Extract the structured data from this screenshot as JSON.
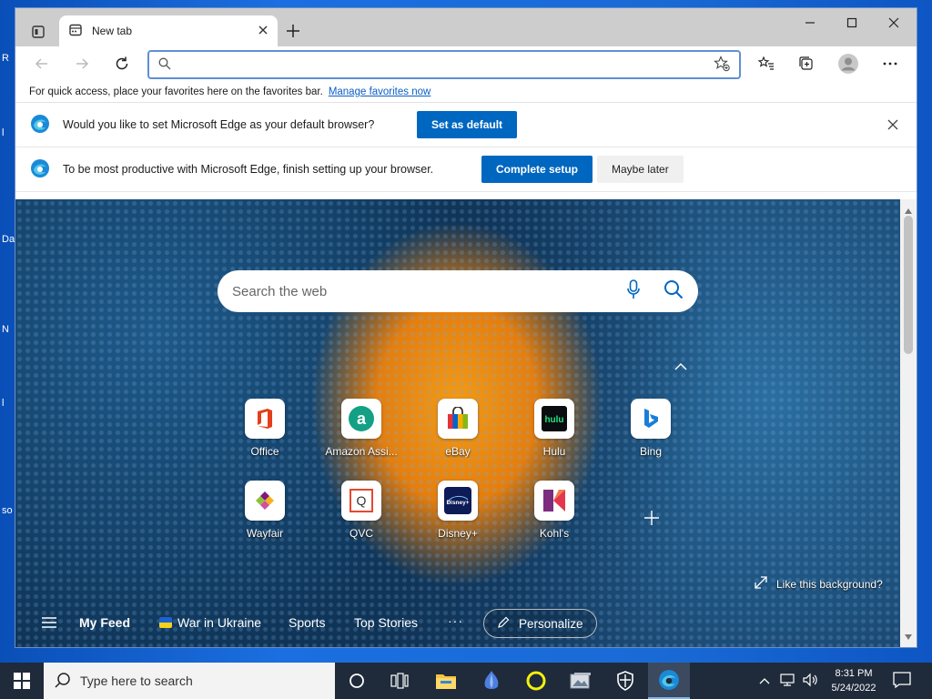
{
  "desktop": {
    "edge_letters": [
      "R",
      "l",
      "Da",
      "N",
      "l",
      "so"
    ]
  },
  "browser": {
    "tab": {
      "title": "New tab"
    },
    "address": {
      "value": "",
      "placeholder": ""
    },
    "favorites_bar": {
      "message": "For quick access, place your favorites here on the favorites bar.",
      "link": "Manage favorites now"
    },
    "infobars": [
      {
        "message": "Would you like to set Microsoft Edge as your default browser?",
        "button": "Set as default"
      },
      {
        "message": "To be most productive with Microsoft Edge, finish setting up your browser.",
        "primary": "Complete setup",
        "secondary": "Maybe later"
      }
    ]
  },
  "ntp": {
    "search_placeholder": "Search the web",
    "tiles": [
      {
        "label": "Office",
        "icon": "office-icon"
      },
      {
        "label": "Amazon Assi...",
        "icon": "amazon-icon"
      },
      {
        "label": "eBay",
        "icon": "ebay-icon"
      },
      {
        "label": "Hulu",
        "icon": "hulu-icon"
      },
      {
        "label": "Bing",
        "icon": "bing-icon"
      },
      {
        "label": "Wayfair",
        "icon": "wayfair-icon"
      },
      {
        "label": "QVC",
        "icon": "qvc-icon"
      },
      {
        "label": "Disney+",
        "icon": "disney-icon"
      },
      {
        "label": "Kohl's",
        "icon": "kohls-icon"
      }
    ],
    "like_background": "Like this background?",
    "feed": {
      "my_feed": "My Feed",
      "tabs": [
        "War in Ukraine",
        "Sports",
        "Top Stories"
      ],
      "more": "···",
      "personalize": "Personalize"
    },
    "hulu_text": "hulu",
    "qvc_text": "Q",
    "disney_text": "Disney+",
    "amazon_text": "a"
  },
  "taskbar": {
    "search_placeholder": "Type here to search",
    "time": "8:31 PM",
    "date": "5/24/2022"
  },
  "colors": {
    "accent": "#0067c0",
    "link": "#0a5fc4",
    "taskbar": "#1f2a3a"
  }
}
